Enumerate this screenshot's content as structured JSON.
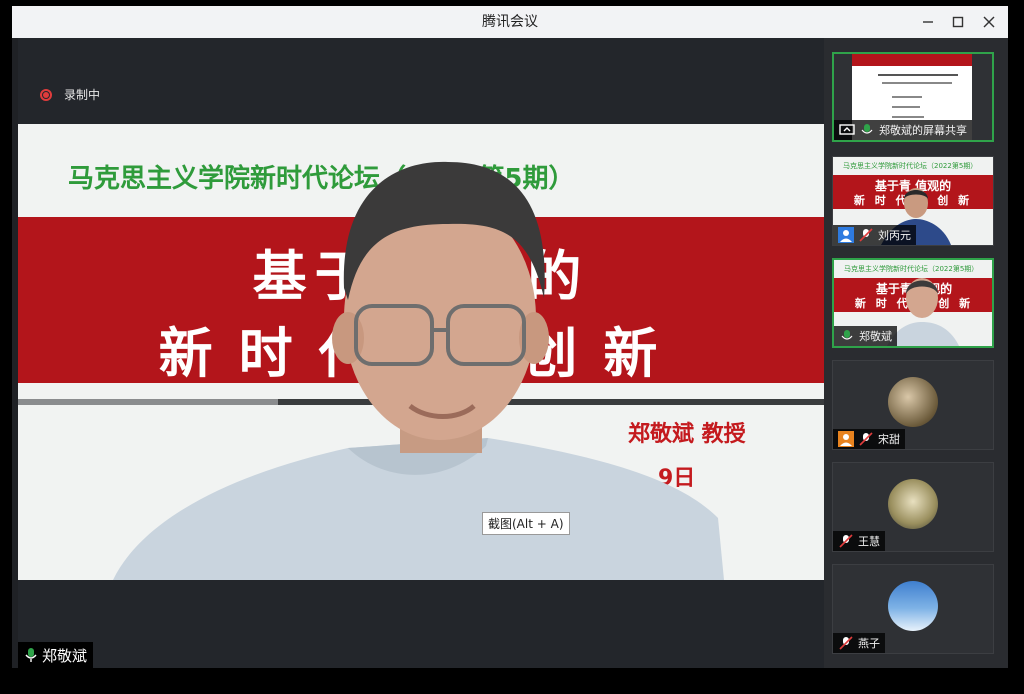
{
  "window": {
    "title": "腾讯会议"
  },
  "recording": {
    "label": "录制中"
  },
  "slide": {
    "top_line": "马克思主义学院新时代论坛（2022第5期）",
    "title_line1": "基于青    观的",
    "title_line2": "新时代    课创新",
    "author": "郑敬斌 教授",
    "date": "9日"
  },
  "tooltip": {
    "text": "截图(Alt + A)"
  },
  "main_speaker": {
    "name": "郑敬斌"
  },
  "participants": [
    {
      "name": "郑敬斌的屏幕共享",
      "type": "screen-share"
    },
    {
      "name": "刘丙元",
      "type": "video"
    },
    {
      "name": "郑敬斌",
      "type": "video"
    },
    {
      "name": "宋甜",
      "type": "avatar"
    },
    {
      "name": "王慧",
      "type": "avatar"
    },
    {
      "name": "燕子",
      "type": "avatar"
    }
  ],
  "mini_slide": {
    "top": "马克思主义学院新时代论坛（2022第5期）",
    "line1": "基于青    值观的",
    "line2": "新 时 代    课 创 新"
  },
  "colors": {
    "accent_green": "#2fa34a",
    "slide_red": "#b3151b",
    "slide_green": "#2f9b3b"
  }
}
